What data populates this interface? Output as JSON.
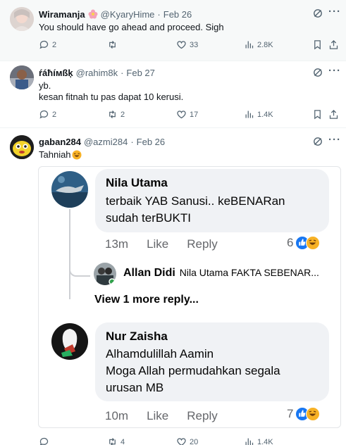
{
  "tweets": [
    {
      "name": "Wiramanja",
      "handle": "@KyaryHime",
      "date": "Feb 26",
      "text": "You should have go ahead and proceed. Sigh",
      "replies": "2",
      "retweets": "",
      "likes": "33",
      "views": "2.8K"
    },
    {
      "name": "ŕáħíмßķ",
      "handle": "@rahim8k",
      "date": "Feb 27",
      "text_line1": "yb.",
      "text_line2": "kesan fitnah tu pas dapat 10 kerusi.",
      "replies": "2",
      "retweets": "2",
      "likes": "17",
      "views": "1.4K"
    },
    {
      "name": "gaban284",
      "handle": "@azmi284",
      "date": "Feb 26",
      "text": "Tahniah",
      "replies": "",
      "retweets": "4",
      "likes": "20",
      "views": "1.4K"
    }
  ],
  "separator": "·",
  "more_label": "···",
  "fb": {
    "comment1": {
      "name": "Nila Utama",
      "line1": "terbaik YAB Sanusi.. keBENARan",
      "line2": "sudah terBUKTI",
      "time": "13m",
      "like": "Like",
      "reply": "Reply",
      "reaction_count": "6"
    },
    "reply_preview": {
      "name": "Allan Didi",
      "text": "Nila Utama FAKTA SEBENAR..."
    },
    "view_more": "View 1 more reply...",
    "comment2": {
      "name": "Nur Zaisha",
      "line1": "Alhamdulillah Aamin",
      "line2": "Moga Allah permudahkan segala",
      "line3": "urusan MB",
      "time": "10m",
      "like": "Like",
      "reply": "Reply",
      "reaction_count": "7"
    }
  },
  "colors": {
    "text": "#0f1419",
    "muted": "#536471",
    "fb_bubble": "#f0f2f5",
    "fb_blue": "#1877f2",
    "haha_yellow": "#f7b125"
  },
  "icons": [
    "reply-icon",
    "retweet-icon",
    "like-icon",
    "views-icon",
    "bookmark-icon",
    "share-icon",
    "grok-icon",
    "more-icon",
    "flower-emoji-icon",
    "laugh-emoji-icon",
    "like-reaction-icon",
    "haha-reaction-icon"
  ]
}
